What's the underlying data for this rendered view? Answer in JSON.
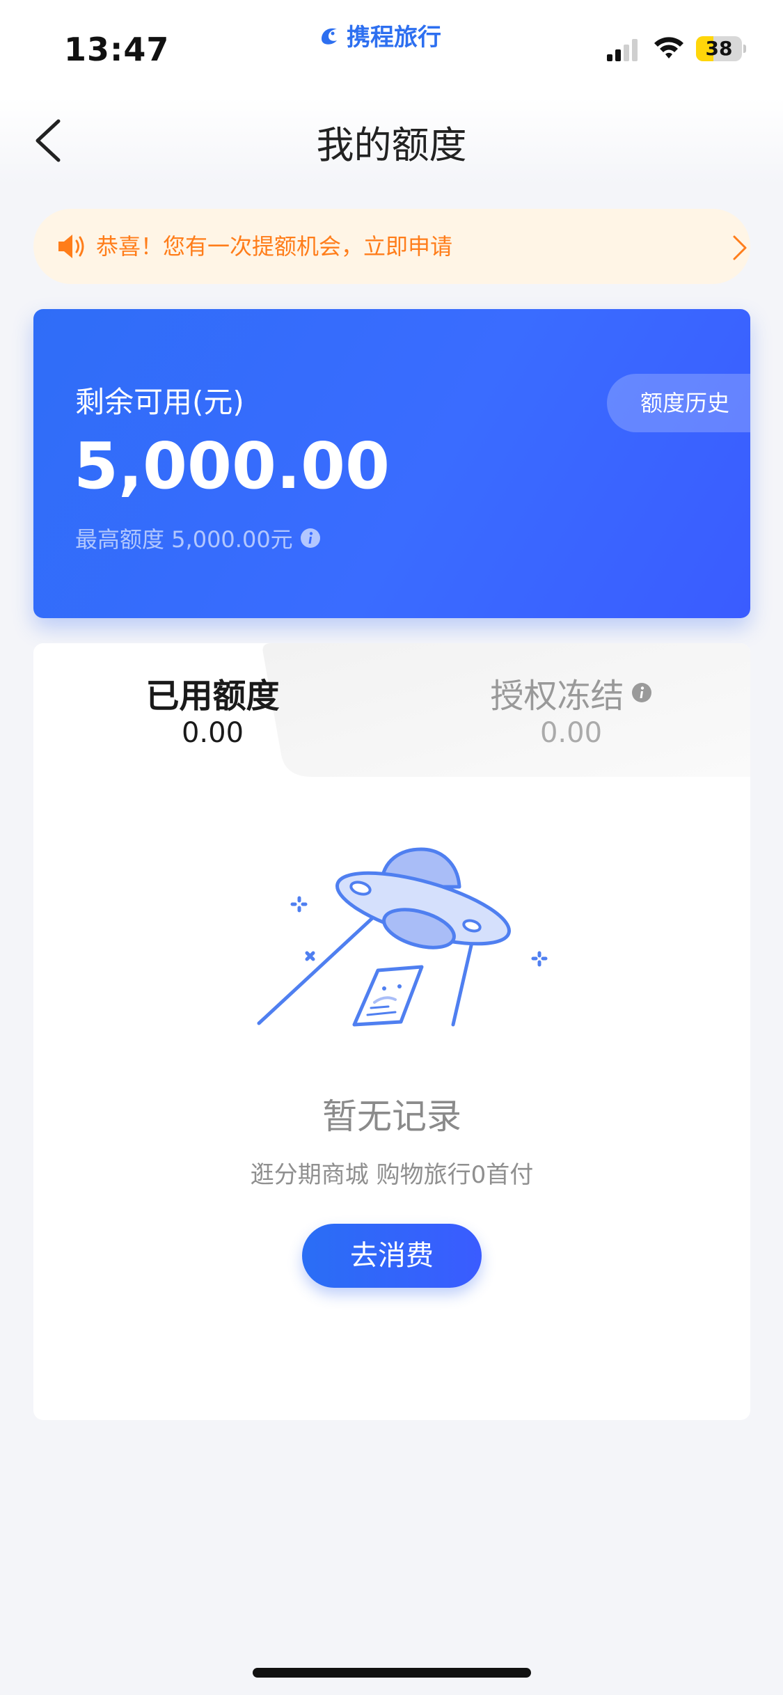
{
  "status_bar": {
    "time": "13:47",
    "brand": "携程旅行",
    "battery_level": 38,
    "battery_color": "#ffd60a"
  },
  "nav": {
    "title": "我的额度",
    "back_icon": "chevron-left-icon"
  },
  "notice": {
    "text": "恭喜！您有一次提额机会，立即申请",
    "color": "#ff7d1a",
    "icon": "speaker-icon"
  },
  "balance_card": {
    "label": "剩余可用(元)",
    "amount": "5,000.00",
    "max_limit": "最高额度 5,000.00元",
    "history_button": "额度历史",
    "accent": "#2f6df7"
  },
  "tabs": [
    {
      "title": "已用额度",
      "value": "0.00",
      "active": true
    },
    {
      "title": "授权冻结",
      "value": "0.00",
      "active": false
    }
  ],
  "empty_state": {
    "title": "暂无记录",
    "subtitle": "逛分期商城 购物旅行0首付",
    "button": "去消费",
    "illustration": "ufo-empty-illustration"
  }
}
